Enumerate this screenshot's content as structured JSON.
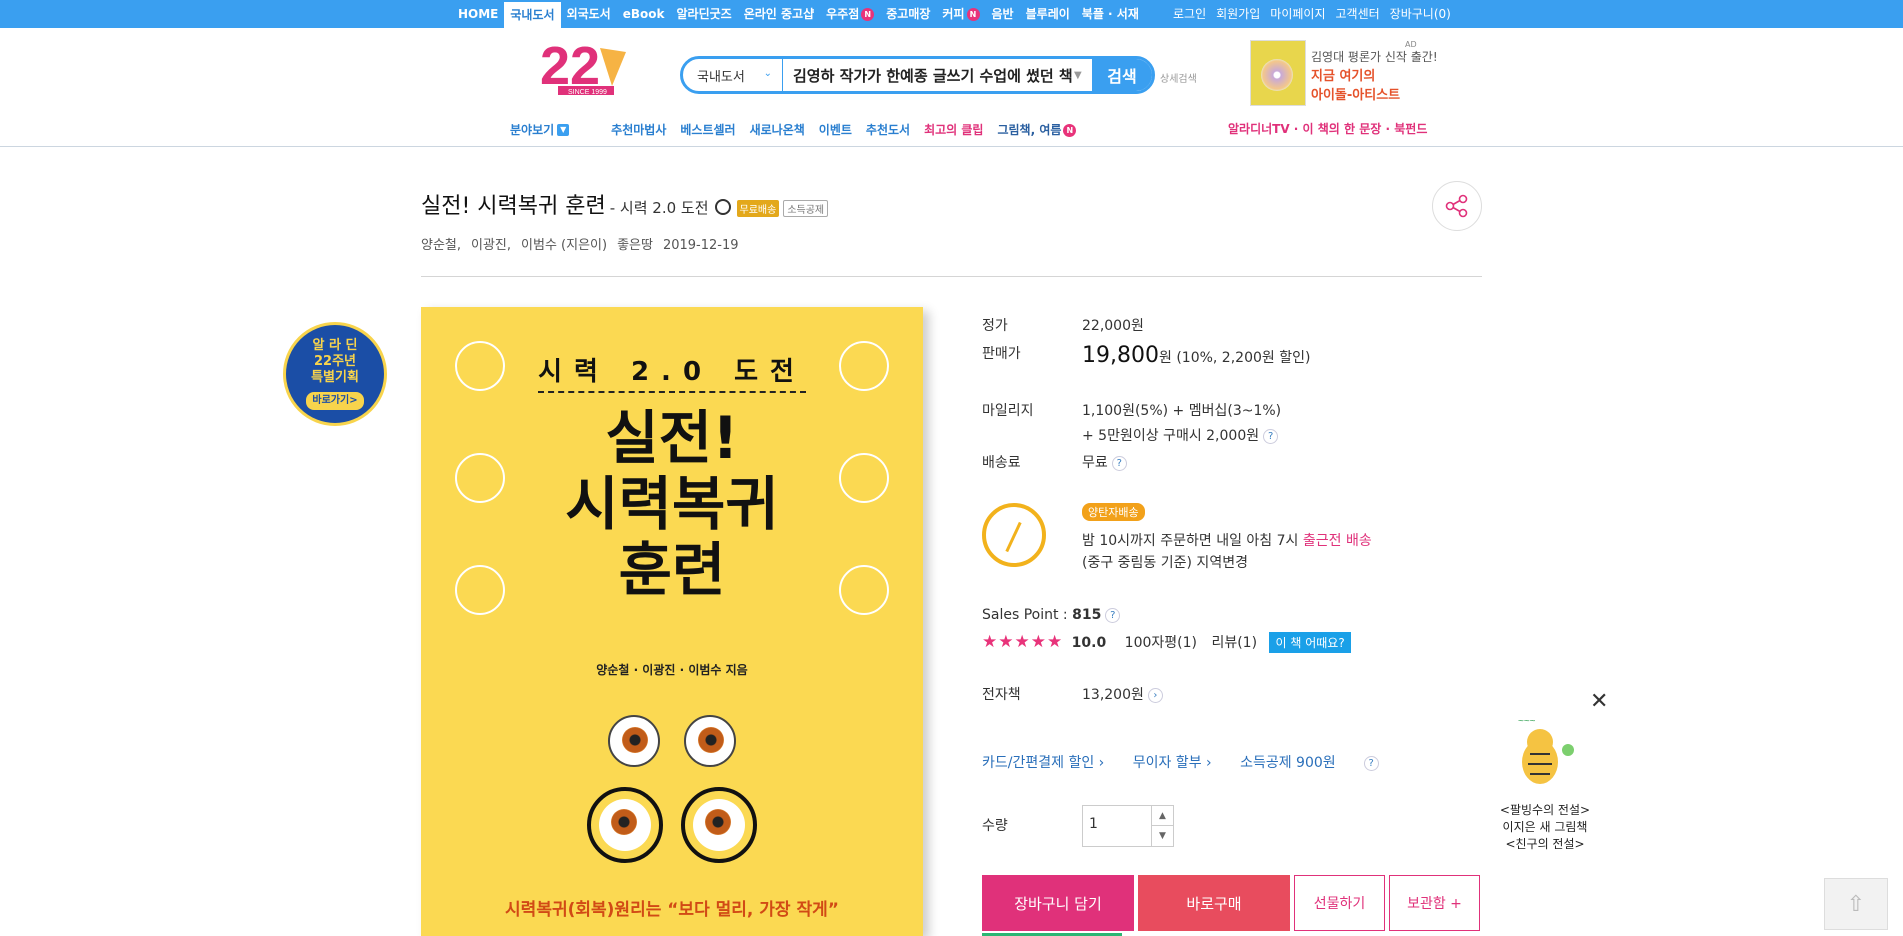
{
  "topnav": {
    "items": [
      "HOME",
      "국내도서",
      "외국도서",
      "eBook",
      "알라딘굿즈",
      "온라인 중고샵",
      "우주점",
      "중고매장",
      "커피",
      "음반",
      "블루레이",
      "북플 · 서재"
    ],
    "right": [
      "로그인",
      "회원가입",
      "마이페이지",
      "고객센터",
      "장바구니(0)"
    ],
    "new_badge": "N"
  },
  "logo": {
    "number": "22",
    "since": "SINCE 1999"
  },
  "search": {
    "category": "국내도서",
    "query": "김영하 작가가 한예종 글쓰기 수업에 썼던 책",
    "button": "검색",
    "advanced": "상세검색"
  },
  "ad": {
    "line1": "김영대 평론가 신작 출간!",
    "line2": "지금 여기의",
    "line3": "아이돌-아티스트",
    "tag": "AD"
  },
  "subnav": {
    "items": [
      "분야보기",
      "추천마법사",
      "베스트셀러",
      "새로나온책",
      "이벤트",
      "추천도서",
      "최고의 클립",
      "그림책, 여름"
    ],
    "right": "알라디너TV · 이 책의 한 문장 · 북펀드"
  },
  "book": {
    "title": "실전! 시력복귀 훈련",
    "subtitle": "- 시력 2.0 도전",
    "badge_free": "무료배송",
    "badge_tax": "소득공제",
    "authors": [
      "양순철,",
      "이광진,",
      "이범수 (지은이)"
    ],
    "publisher": "좋은땅",
    "date": "2019-12-19"
  },
  "promo": {
    "line1": "알 라 딘",
    "line2": "22주년",
    "line3": "특별기획",
    "go": "바로가기>"
  },
  "cover": {
    "top": "시력 2.0 도전",
    "main1": "실전!",
    "main2": "시력복귀",
    "main3": "훈련",
    "authors": "양순철 · 이광진 · 이범수 지음",
    "bottom": "시력복귀(회복)원리는 “보다 멀리, 가장 작게”"
  },
  "info": {
    "list_price_label": "정가",
    "list_price": "22,000원",
    "sale_price_label": "판매가",
    "sale_price": "19,800",
    "sale_unit": "원",
    "sale_discount": "(10%, 2,200원 할인)",
    "mileage_label": "마일리지",
    "mileage_line1": "1,100원(5%) + 멤버십(3~1%)",
    "mileage_line2": "+ 5만원이상 구매시 2,000원",
    "shipping_label": "배송료",
    "shipping_value": "무료",
    "delivery_badge": "양탄자배송",
    "delivery_line1_a": "밤 10시까지 주문하면 내일 아침 7시 ",
    "delivery_line1_b": "출근전 배송",
    "delivery_line2": "(중구 중림동 기준) 지역변경",
    "sales_point_label": "Sales Point : ",
    "sales_point": "815",
    "rating": "10.0",
    "review100": "100자평(1)",
    "reviews": "리뷰(1)",
    "review_btn": "이 책 어때요?",
    "ebook_label": "전자책",
    "ebook_price": "13,200원",
    "link_card": "카드/간편결제 할인 ›",
    "link_installment": "무이자 할부 ›",
    "link_tax": "소득공제 900원",
    "qty_label": "수량",
    "qty": "1",
    "btn_cart": "장바구니 담기",
    "btn_buy": "바로구매",
    "btn_gift": "선물하기",
    "btn_save": "보관함 +"
  },
  "side_ad": {
    "line1": "<팔빙수의 전설>",
    "line2": "이지은 새 그림책",
    "line3": "<친구의 전설>"
  }
}
